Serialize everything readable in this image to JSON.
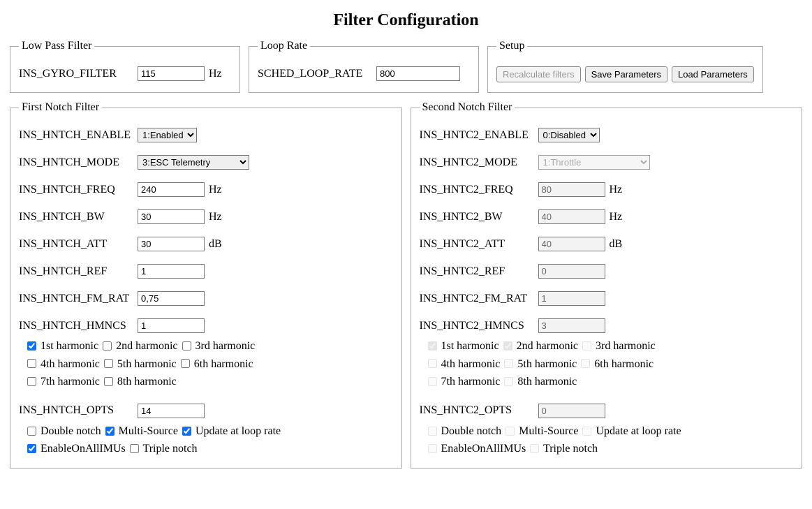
{
  "title": "Filter Configuration",
  "lowpass": {
    "legend": "Low Pass Filter",
    "param": "INS_GYRO_FILTER",
    "value": "115",
    "unit": "Hz"
  },
  "looprate": {
    "legend": "Loop Rate",
    "param": "SCHED_LOOP_RATE",
    "value": "800"
  },
  "setup": {
    "legend": "Setup",
    "recalc": "Recalculate filters",
    "save": "Save Parameters",
    "load": "Load Parameters"
  },
  "notch1": {
    "legend": "First Notch Filter",
    "enable_param": "INS_HNTCH_ENABLE",
    "enable_value": "1:Enabled",
    "mode_param": "INS_HNTCH_MODE",
    "mode_value": "3:ESC Telemetry",
    "freq_param": "INS_HNTCH_FREQ",
    "freq_value": "240",
    "freq_unit": "Hz",
    "bw_param": "INS_HNTCH_BW",
    "bw_value": "30",
    "bw_unit": "Hz",
    "att_param": "INS_HNTCH_ATT",
    "att_value": "30",
    "att_unit": "dB",
    "ref_param": "INS_HNTCH_REF",
    "ref_value": "1",
    "fmrat_param": "INS_HNTCH_FM_RAT",
    "fmrat_value": "0,75",
    "hmncs_param": "INS_HNTCH_HMNCS",
    "hmncs_value": "1",
    "harmonics": [
      {
        "label": "1st harmonic",
        "checked": true
      },
      {
        "label": "2nd harmonic",
        "checked": false
      },
      {
        "label": "3rd harmonic",
        "checked": false
      },
      {
        "label": "4th harmonic",
        "checked": false
      },
      {
        "label": "5th harmonic",
        "checked": false
      },
      {
        "label": "6th harmonic",
        "checked": false
      },
      {
        "label": "7th harmonic",
        "checked": false
      },
      {
        "label": "8th harmonic",
        "checked": false
      }
    ],
    "opts_param": "INS_HNTCH_OPTS",
    "opts_value": "14",
    "opts": [
      {
        "label": "Double notch",
        "checked": false
      },
      {
        "label": "Multi-Source",
        "checked": true
      },
      {
        "label": "Update at loop rate",
        "checked": true
      },
      {
        "label": "EnableOnAllIMUs",
        "checked": true
      },
      {
        "label": "Triple notch",
        "checked": false
      }
    ],
    "enabled": true
  },
  "notch2": {
    "legend": "Second Notch Filter",
    "enable_param": "INS_HNTC2_ENABLE",
    "enable_value": "0:Disabled",
    "mode_param": "INS_HNTC2_MODE",
    "mode_value": "1:Throttle",
    "freq_param": "INS_HNTC2_FREQ",
    "freq_value": "80",
    "freq_unit": "Hz",
    "bw_param": "INS_HNTC2_BW",
    "bw_value": "40",
    "bw_unit": "Hz",
    "att_param": "INS_HNTC2_ATT",
    "att_value": "40",
    "att_unit": "dB",
    "ref_param": "INS_HNTC2_REF",
    "ref_value": "0",
    "fmrat_param": "INS_HNTC2_FM_RAT",
    "fmrat_value": "1",
    "hmncs_param": "INS_HNTC2_HMNCS",
    "hmncs_value": "3",
    "harmonics": [
      {
        "label": "1st harmonic",
        "checked": true
      },
      {
        "label": "2nd harmonic",
        "checked": true
      },
      {
        "label": "3rd harmonic",
        "checked": false
      },
      {
        "label": "4th harmonic",
        "checked": false
      },
      {
        "label": "5th harmonic",
        "checked": false
      },
      {
        "label": "6th harmonic",
        "checked": false
      },
      {
        "label": "7th harmonic",
        "checked": false
      },
      {
        "label": "8th harmonic",
        "checked": false
      }
    ],
    "opts_param": "INS_HNTC2_OPTS",
    "opts_value": "0",
    "opts": [
      {
        "label": "Double notch",
        "checked": false
      },
      {
        "label": "Multi-Source",
        "checked": false
      },
      {
        "label": "Update at loop rate",
        "checked": false
      },
      {
        "label": "EnableOnAllIMUs",
        "checked": false
      },
      {
        "label": "Triple notch",
        "checked": false
      }
    ],
    "enabled": false
  }
}
